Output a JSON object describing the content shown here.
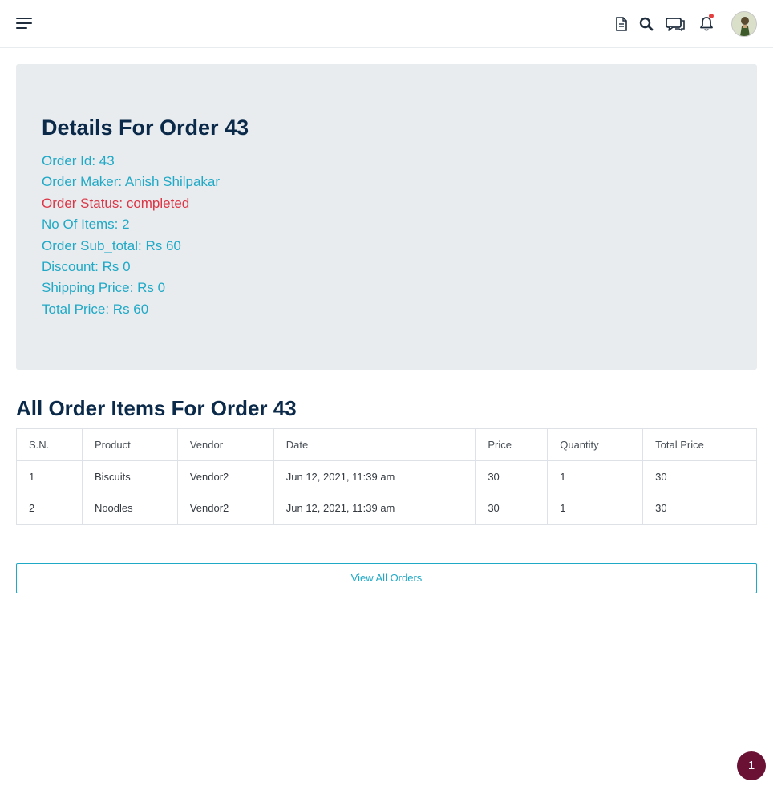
{
  "header": {
    "icons": [
      "menu-icon",
      "document-icon",
      "search-icon",
      "chat-icon",
      "bell-icon",
      "avatar"
    ],
    "notification_dot_color": "#e53e3e"
  },
  "details": {
    "title": "Details For Order 43",
    "order_id": "Order Id: 43",
    "order_maker": "Order Maker: Anish Shilpakar",
    "order_status": "Order Status: completed",
    "num_items": "No Of Items: 2",
    "sub_total": "Order Sub_total: Rs 60",
    "discount": "Discount: Rs 0",
    "shipping": "Shipping Price: Rs 0",
    "total": "Total Price: Rs 60"
  },
  "items": {
    "title": "All Order Items For Order 43",
    "headers": [
      "S.N.",
      "Product",
      "Vendor",
      "Date",
      "Price",
      "Quantity",
      "Total Price"
    ],
    "rows": [
      [
        "1",
        "Biscuits",
        "Vendor2",
        "Jun 12, 2021, 11:39 am",
        "30",
        "1",
        "30"
      ],
      [
        "2",
        "Noodles",
        "Vendor2",
        "Jun 12, 2021, 11:39 am",
        "30",
        "1",
        "30"
      ]
    ]
  },
  "actions": {
    "view_all": "View All Orders"
  },
  "floating_badge": "1",
  "colors": {
    "accent": "#20a9c6",
    "status": "#dc3545",
    "heading": "#0b2a4a",
    "card_bg": "#e9ecef",
    "badge": "#6b1134"
  }
}
